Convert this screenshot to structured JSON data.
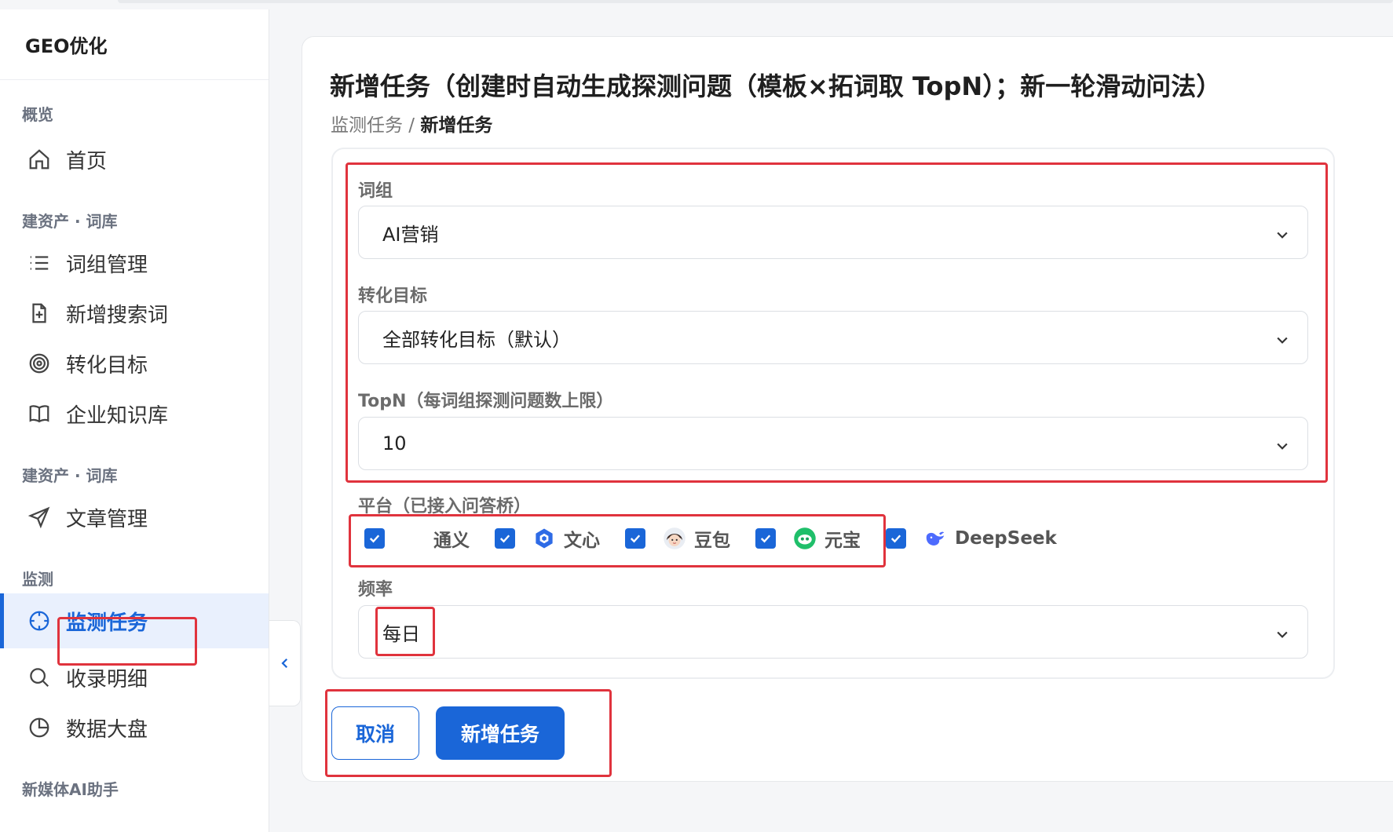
{
  "sidebar": {
    "brand": "GEO优化",
    "groups": [
      {
        "label": "概览"
      },
      {
        "label": "建资产 · 词库"
      },
      {
        "label": "建资产 · 词库"
      },
      {
        "label": "监测"
      },
      {
        "label": "新媒体AI助手"
      }
    ],
    "items": [
      {
        "label": "首页",
        "icon": "home-icon"
      },
      {
        "label": "词组管理",
        "icon": "list-icon"
      },
      {
        "label": "新增搜索词",
        "icon": "file-plus-icon"
      },
      {
        "label": "转化目标",
        "icon": "target-icon"
      },
      {
        "label": "企业知识库",
        "icon": "book-icon"
      },
      {
        "label": "文章管理",
        "icon": "send-icon"
      },
      {
        "label": "监测任务",
        "icon": "crosshair-icon",
        "active": true
      },
      {
        "label": "收录明细",
        "icon": "search-icon"
      },
      {
        "label": "数据大盘",
        "icon": "pie-chart-icon"
      }
    ]
  },
  "header": {
    "title": "新增任务（创建时自动生成探测问题（模板×拓词取 TopN）；新一轮滑动问法）",
    "breadcrumb_parent": "监测任务",
    "breadcrumb_sep": " / ",
    "breadcrumb_current": "新增任务"
  },
  "form": {
    "wordgroup_label": "词组",
    "wordgroup_value": "AI营销",
    "target_label": "转化目标",
    "target_value": "全部转化目标（默认）",
    "topn_label": "TopN（每词组探测问题数上限）",
    "topn_value": "10",
    "platform_label": "平台（已接入问答桥）",
    "platforms": [
      {
        "name": "通义",
        "checked": true,
        "icon": "tongyi-logo-icon"
      },
      {
        "name": "文心",
        "checked": true,
        "icon": "wenxin-logo-icon"
      },
      {
        "name": "豆包",
        "checked": true,
        "icon": "doubao-logo-icon"
      },
      {
        "name": "元宝",
        "checked": true,
        "icon": "yuanbao-logo-icon"
      },
      {
        "name": "DeepSeek",
        "checked": true,
        "icon": "deepseek-logo-icon"
      }
    ],
    "frequency_label": "频率",
    "frequency_value": "每日"
  },
  "actions": {
    "cancel_label": "取消",
    "submit_label": "新增任务"
  },
  "colors": {
    "accent": "#1a66d8",
    "annotation": "#e0333d",
    "active_bg": "#e9f0fd"
  }
}
